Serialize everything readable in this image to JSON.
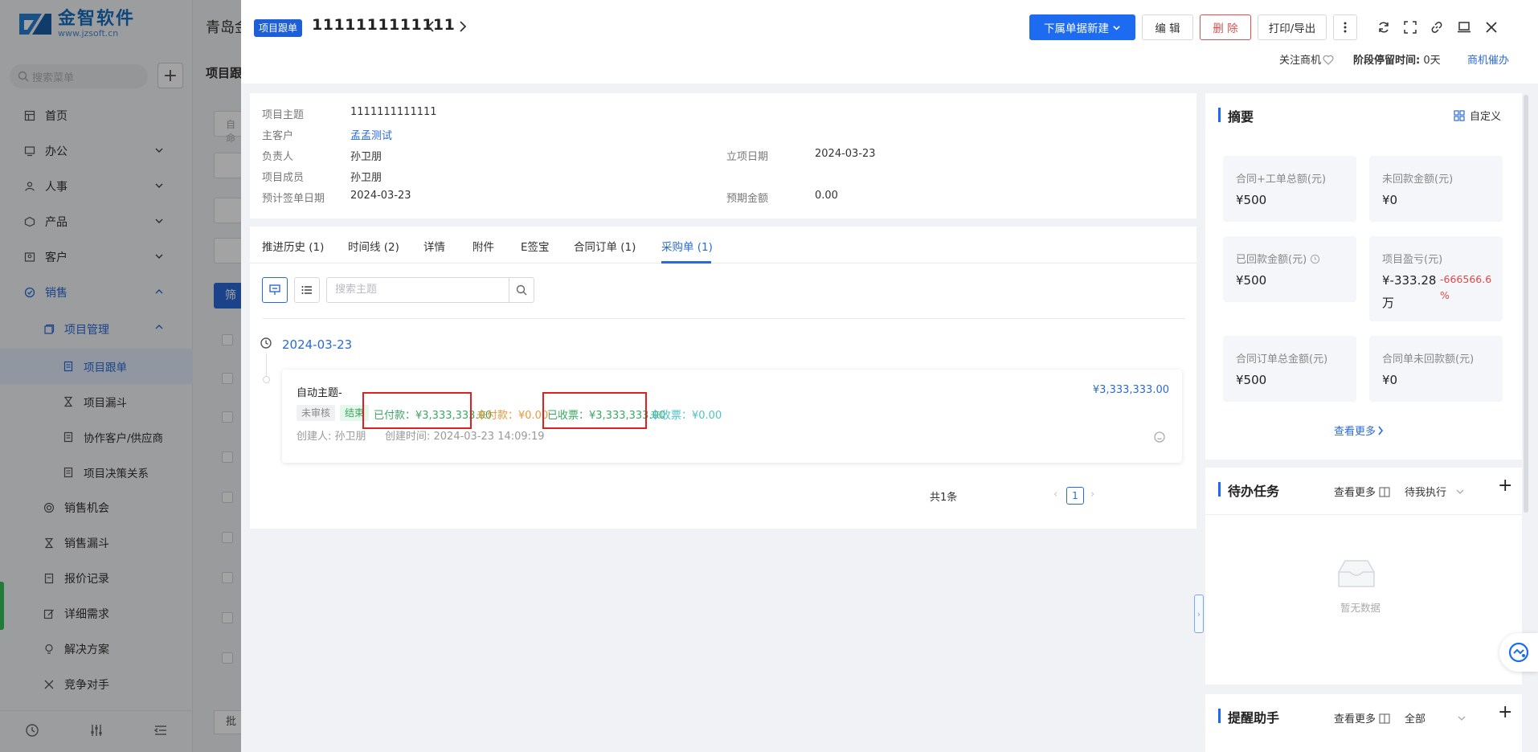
{
  "sidebar": {
    "logo_cn": "金智软件",
    "logo_en": "www.jzsoft.cn",
    "search_placeholder": "搜索菜单",
    "items": [
      {
        "label": "首页"
      },
      {
        "label": "办公"
      },
      {
        "label": "人事"
      },
      {
        "label": "产品"
      },
      {
        "label": "客户"
      },
      {
        "label": "销售"
      },
      {
        "label": "项目管理"
      },
      {
        "label": "项目跟单"
      },
      {
        "label": "项目漏斗"
      },
      {
        "label": "协作客户/供应商"
      },
      {
        "label": "项目决策关系"
      },
      {
        "label": "销售机会"
      },
      {
        "label": "销售漏斗"
      },
      {
        "label": "报价记录"
      },
      {
        "label": "详细需求"
      },
      {
        "label": "解决方案"
      },
      {
        "label": "竞争对手"
      }
    ]
  },
  "background": {
    "company": "青岛金",
    "page_title": "项目跟",
    "filter_btn": "筛",
    "batch_btn": "批",
    "input_hint": "自命"
  },
  "drawer": {
    "tag": "项目跟单",
    "title": "1111111111111",
    "actions": {
      "new_sub": "下属单据新建",
      "edit": "编 辑",
      "delete": "删 除",
      "print": "打印/导出"
    },
    "follow": "关注商机",
    "stay_label": "阶段停留时间:",
    "stay_value": "0天",
    "remind": "商机催办"
  },
  "info": {
    "subject_label": "项目主题",
    "subject": "1111111111111",
    "customer_label": "主客户",
    "customer": "孟孟测试",
    "owner_label": "负责人",
    "owner": "孙卫朋",
    "start_label": "立项日期",
    "start": "2024-03-23",
    "members_label": "项目成员",
    "members": "孙卫朋",
    "sign_label": "预计签单日期",
    "sign": "2024-03-23",
    "amount_label": "预期金额",
    "amount": "0.00"
  },
  "tabs": [
    {
      "label": "推进历史 (1)"
    },
    {
      "label": "时间线 (2)"
    },
    {
      "label": "详情"
    },
    {
      "label": "附件"
    },
    {
      "label": "E签宝"
    },
    {
      "label": "合同订单 (1)"
    },
    {
      "label": "采购单 (1)"
    }
  ],
  "purchase": {
    "search_placeholder": "搜索主题",
    "date": "2024-03-23",
    "order": {
      "title": "自动主题-",
      "amount": "¥3,333,333.00",
      "badge_audit": "未审核",
      "badge_status": "结束",
      "paid": "已付款：¥3,333,333.00",
      "unpaid": "未付款：¥0.00",
      "invoiced": "已收票：¥3,333,333.00",
      "uninvoiced": "未收票：¥0.00",
      "creator": "创建人: 孙卫朋",
      "created": "创建时间: 2024-03-23 14:09:19"
    },
    "total": "共1条",
    "page": "1"
  },
  "summary": {
    "title": "摘要",
    "customize": "自定义",
    "cells": [
      {
        "label": "合同+工单总额(元)",
        "value": "¥500"
      },
      {
        "label": "未回款金额(元)",
        "value": "¥0"
      },
      {
        "label": "已回款金额(元)",
        "value": "¥500"
      },
      {
        "label": "项目盈亏(元)",
        "value_line1": "¥-333.28",
        "value_line2": "万",
        "sub_line1": "-666566.6",
        "sub_line2": "%"
      },
      {
        "label": "合同订单总金额(元)",
        "value": "¥500"
      },
      {
        "label": "合同单未回款额(元)",
        "value": "¥0"
      }
    ],
    "see_more": "查看更多"
  },
  "todo": {
    "title": "待办任务",
    "see_more": "查看更多",
    "filter": "待我执行",
    "empty": "暂无数据"
  },
  "reminder": {
    "title": "提醒助手",
    "see_more": "查看更多",
    "filter": "全部"
  },
  "colors": {
    "primary": "#1c6bf0",
    "danger": "#e24f4f",
    "paid": "#3aa860",
    "unpaid": "#f0973a",
    "uninvoiced": "#4ec2c8",
    "loss": "#e04848"
  }
}
